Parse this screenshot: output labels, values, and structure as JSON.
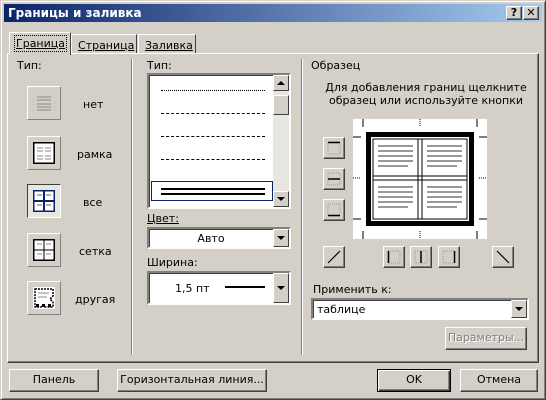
{
  "window": {
    "title": "Границы и заливка"
  },
  "titlebar": {
    "help_label": "?",
    "close_label": "✕"
  },
  "tabs": [
    {
      "label": "Граница",
      "active": true
    },
    {
      "label": "Страница",
      "active": false
    },
    {
      "label": "Заливка",
      "active": false
    }
  ],
  "setting": {
    "heading": "Тип:",
    "options": [
      {
        "label": "нет",
        "icon": "border-none-icon"
      },
      {
        "label": "рамка",
        "icon": "border-box-icon"
      },
      {
        "label": "все",
        "icon": "border-all-icon",
        "selected": true
      },
      {
        "label": "сетка",
        "icon": "border-grid-icon"
      },
      {
        "label": "другая",
        "icon": "border-custom-icon"
      }
    ]
  },
  "style": {
    "heading": "Тип:",
    "line_styles": [
      "dotted",
      "dashed-short",
      "dashed",
      "dash-dot",
      "double"
    ],
    "selected_style": "double",
    "color_label": "Цвет:",
    "color_value": "Авто",
    "width_label": "Ширина:",
    "width_value": "1,5 пт"
  },
  "preview": {
    "heading": "Образец",
    "hint": "Для добавления границ щелкните образец или используйте кнопки",
    "apply_label": "Применить к:",
    "apply_value": "таблице",
    "options_button": "Параметры..."
  },
  "footer": {
    "panel_button": "Панель",
    "hline_button": "Горизонтальная линия...",
    "ok_button": "OK",
    "cancel_button": "Отмена"
  },
  "colors": {
    "titlebar_start": "#0a246a",
    "titlebar_end": "#a6caf0",
    "face": "#d4d0c8",
    "selection": "#0a246a"
  }
}
